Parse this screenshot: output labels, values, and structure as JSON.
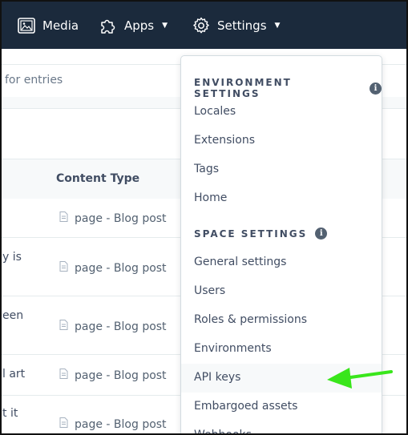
{
  "nav": {
    "media_label": "Media",
    "apps_label": "Apps",
    "settings_label": "Settings"
  },
  "search": {
    "placeholder_fragment": "for entries"
  },
  "table": {
    "content_type_header": "Content Type",
    "rows": [
      {
        "title_fragment": "",
        "content_type": "page - Blog post"
      },
      {
        "title_fragment": "y is",
        "content_type": "page - Blog post"
      },
      {
        "title_fragment": "een",
        "content_type": "page - Blog post"
      },
      {
        "title_fragment": "l art",
        "content_type": "page - Blog post"
      },
      {
        "title_fragment": "t it",
        "content_type": "page - Blog post"
      }
    ]
  },
  "settings_menu": {
    "environment_title": "ENVIRONMENT SETTINGS",
    "environment_items": [
      "Locales",
      "Extensions",
      "Tags",
      "Home"
    ],
    "space_title": "SPACE SETTINGS",
    "space_items": [
      "General settings",
      "Users",
      "Roles & permissions",
      "Environments",
      "API keys",
      "Embargoed assets",
      "Webhooks"
    ],
    "highlighted_item": "API keys"
  },
  "colors": {
    "nav_bg": "#1b2a3c",
    "arrow": "#39e61b",
    "text": "#414d63"
  },
  "icons": [
    "media-icon",
    "apps-puzzle-icon",
    "settings-gear-icon",
    "caret-down-icon",
    "info-icon",
    "document-icon",
    "green-arrow-annotation"
  ]
}
